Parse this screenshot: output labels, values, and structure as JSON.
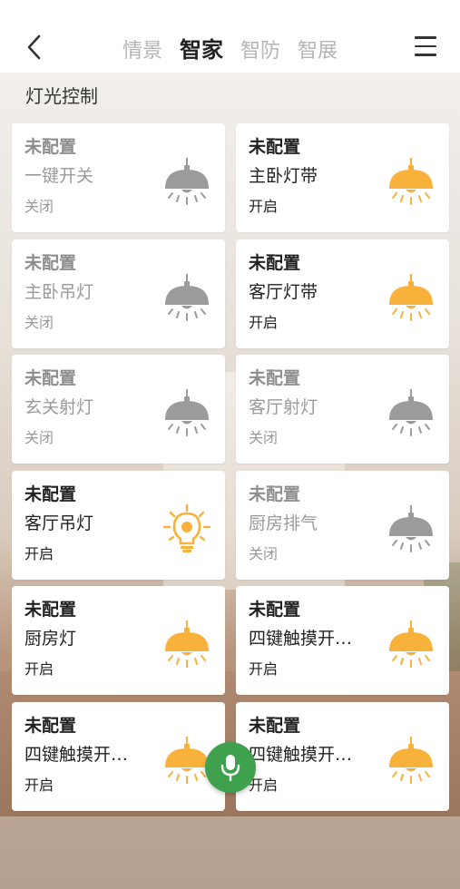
{
  "header": {
    "tabs": [
      {
        "label": "情景",
        "active": false
      },
      {
        "label": "智家",
        "active": true
      },
      {
        "label": "智防",
        "active": false
      },
      {
        "label": "智展",
        "active": false
      }
    ]
  },
  "section": {
    "title": "灯光控制"
  },
  "colors": {
    "on": "#f8b13b",
    "off": "#9b9b9b",
    "mic": "#3fa14e"
  },
  "devices": [
    {
      "config": "未配置",
      "name": "一键开关",
      "status": "关闭",
      "on": false,
      "icon": "ceiling-lamp-icon"
    },
    {
      "config": "未配置",
      "name": "主卧灯带",
      "status": "开启",
      "on": true,
      "icon": "ceiling-lamp-icon"
    },
    {
      "config": "未配置",
      "name": "主卧吊灯",
      "status": "关闭",
      "on": false,
      "icon": "ceiling-lamp-icon"
    },
    {
      "config": "未配置",
      "name": "客厅灯带",
      "status": "开启",
      "on": true,
      "icon": "ceiling-lamp-icon"
    },
    {
      "config": "未配置",
      "name": "玄关射灯",
      "status": "关闭",
      "on": false,
      "icon": "ceiling-lamp-icon"
    },
    {
      "config": "未配置",
      "name": "客厅射灯",
      "status": "关闭",
      "on": false,
      "icon": "ceiling-lamp-icon"
    },
    {
      "config": "未配置",
      "name": "客厅吊灯",
      "status": "开启",
      "on": true,
      "icon": "light-bulb-icon"
    },
    {
      "config": "未配置",
      "name": "厨房排气",
      "status": "关闭",
      "on": false,
      "icon": "ceiling-lamp-icon"
    },
    {
      "config": "未配置",
      "name": "厨房灯",
      "status": "开启",
      "on": true,
      "icon": "ceiling-lamp-icon"
    },
    {
      "config": "未配置",
      "name": "四键触摸开…",
      "status": "开启",
      "on": true,
      "icon": "ceiling-lamp-icon"
    },
    {
      "config": "未配置",
      "name": "四键触摸开…",
      "status": "开启",
      "on": true,
      "icon": "ceiling-lamp-icon"
    },
    {
      "config": "未配置",
      "name": "四键触摸开…",
      "status": "开启",
      "on": true,
      "icon": "ceiling-lamp-icon"
    }
  ]
}
